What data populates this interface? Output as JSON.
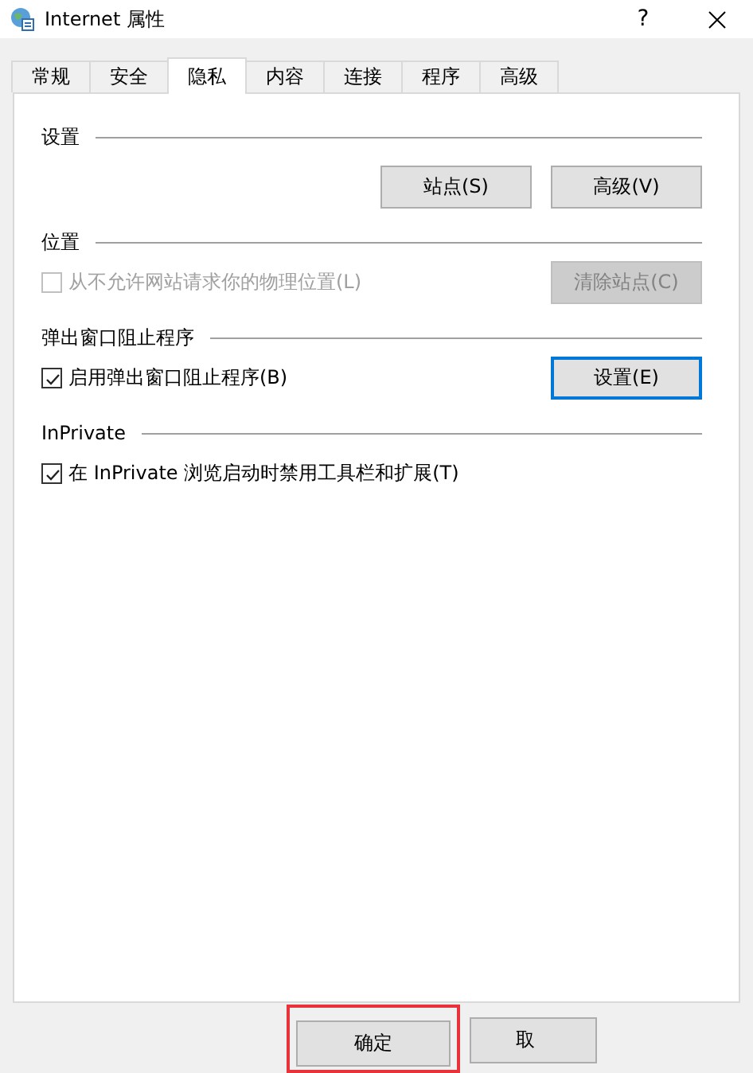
{
  "window": {
    "title": "Internet 属性",
    "help": "?"
  },
  "tabs": [
    {
      "label": "常规",
      "selected": false
    },
    {
      "label": "安全",
      "selected": false
    },
    {
      "label": "隐私",
      "selected": true
    },
    {
      "label": "内容",
      "selected": false
    },
    {
      "label": "连接",
      "selected": false
    },
    {
      "label": "程序",
      "selected": false
    },
    {
      "label": "高级",
      "selected": false
    }
  ],
  "sections": [
    {
      "title": "设置",
      "items": [
        {
          "kind": "button",
          "label": "站点(S)",
          "disabled": false,
          "focused": false
        },
        {
          "kind": "button",
          "label": "高级(V)",
          "disabled": false,
          "focused": false
        }
      ]
    },
    {
      "title": "位置",
      "items": [
        {
          "kind": "checkbox",
          "label": "从不允许网站请求你的物理位置(L)",
          "checked": false,
          "disabled": true
        },
        {
          "kind": "button",
          "label": "清除站点(C)",
          "disabled": true,
          "focused": false
        }
      ]
    },
    {
      "title": "弹出窗口阻止程序",
      "items": [
        {
          "kind": "checkbox",
          "label": "启用弹出窗口阻止程序(B)",
          "checked": true,
          "disabled": false
        },
        {
          "kind": "button",
          "label": "设置(E)",
          "disabled": false,
          "focused": true
        }
      ]
    },
    {
      "title": "InPrivate",
      "items": [
        {
          "kind": "checkbox",
          "label": "在 InPrivate 浏览启动时禁用工具栏和扩展(T)",
          "checked": true,
          "disabled": false
        }
      ]
    }
  ],
  "footer_buttons": [
    {
      "label": "确定",
      "highlighted": true
    },
    {
      "label": "取",
      "highlighted": false
    }
  ]
}
